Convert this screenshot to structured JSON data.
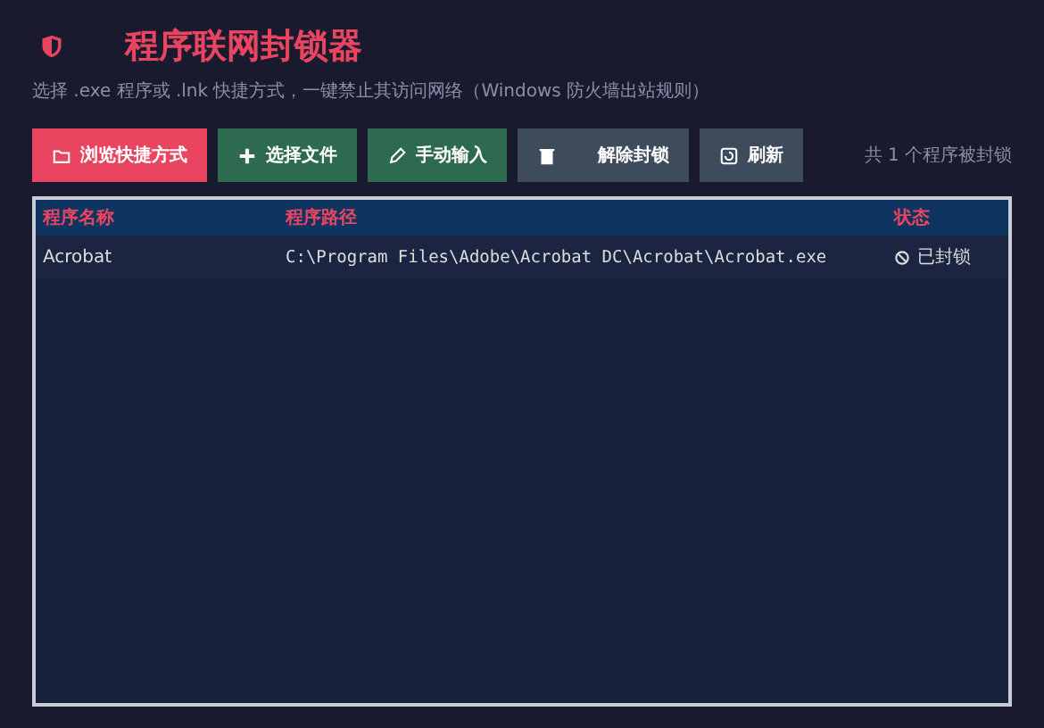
{
  "header": {
    "title": "程序联网封锁器",
    "subtitle": "选择 .exe 程序或 .lnk 快捷方式，一键禁止其访问网络（Windows 防火墙出站规则）"
  },
  "toolbar": {
    "buttons": [
      {
        "label": "浏览快捷方式",
        "kind": "primary"
      },
      {
        "label": "选择文件",
        "kind": "success"
      },
      {
        "label": "手动输入",
        "kind": "success"
      },
      {
        "label": "解除封锁",
        "kind": "neutral"
      },
      {
        "label": "刷新",
        "kind": "neutral"
      }
    ],
    "count": "共 1 个程序被封锁"
  },
  "table": {
    "columns": [
      "程序名称",
      "程序路径",
      "状态"
    ],
    "rows": [
      {
        "name": "Acrobat",
        "path": "C:\\Program Files\\Adobe\\Acrobat DC\\Acrobat\\Acrobat.exe",
        "status": "已封锁"
      }
    ]
  }
}
